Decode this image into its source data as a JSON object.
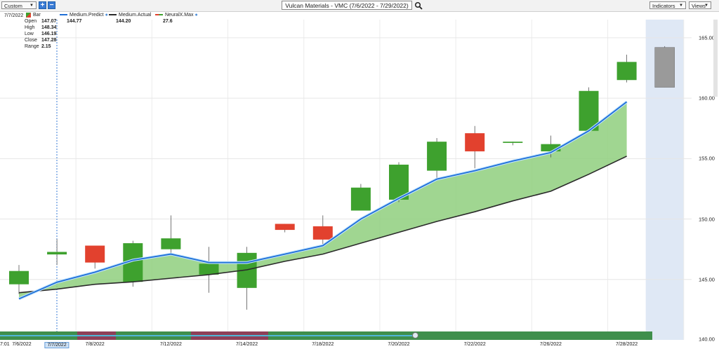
{
  "toolbar": {
    "range_select": "Custom",
    "plus": "+",
    "minus": "−",
    "title": "Vulcan Materials - VMC (7/6/2022 - 7/29/2022)",
    "indicators_label": "Indicators",
    "views_label": "Views"
  },
  "info_panel": {
    "date": "7/7/2022",
    "open_label": "Open",
    "open": "147.07",
    "high_label": "High",
    "high": "148.34",
    "low_label": "Low",
    "low": "146.19",
    "close_label": "Close",
    "close": "147.28",
    "range_label": "Range",
    "range": "2.15"
  },
  "legend": {
    "bar_label": "Bar",
    "predict_label": "Medium.Predict",
    "predict_value": "144.77",
    "actual_label": "Medium.Actual",
    "actual_value": "144.20",
    "neuralx_label": "NeuralX.Max",
    "neuralx_value": "27.6"
  },
  "colors": {
    "up": "#3ea12e",
    "down": "#e2412e",
    "forecast": "#9a9a9a",
    "predict_line": "#1f6fd6",
    "actual_line": "#2a2a2a",
    "fill": "#8fcf7e",
    "highlight": "#dfe8f5"
  },
  "axis_dates": [
    "7/6/2022",
    "7/7/2022",
    "7/8/2022",
    "7/12/2022",
    "7/14/2022",
    "7/18/2022",
    "7/20/2022",
    "7/22/2022",
    "7/26/2022",
    "7/28/2022"
  ],
  "timestamp": "7:01",
  "chart_data": {
    "type": "candlestick",
    "title": "Vulcan Materials - VMC (7/6/2022 - 7/29/2022)",
    "ylim": [
      140,
      166.5
    ],
    "y_ticks": [
      145.0,
      150.0,
      155.0,
      160.0,
      165.0
    ],
    "y_tick_labels": [
      "145.00",
      "150.00",
      "155.00",
      "160.00",
      "165.00"
    ],
    "grid": true,
    "dates": [
      "7/6/2022",
      "7/7/2022",
      "7/8/2022",
      "7/11/2022",
      "7/12/2022",
      "7/13/2022",
      "7/14/2022",
      "7/15/2022",
      "7/18/2022",
      "7/19/2022",
      "7/20/2022",
      "7/21/2022",
      "7/22/2022",
      "7/25/2022",
      "7/26/2022",
      "7/27/2022",
      "7/28/2022",
      "7/29/2022"
    ],
    "candles": [
      {
        "date": "7/6/2022",
        "open": 144.6,
        "high": 146.2,
        "low": 143.8,
        "close": 145.7
      },
      {
        "date": "7/7/2022",
        "open": 147.07,
        "high": 148.34,
        "low": 146.19,
        "close": 147.28
      },
      {
        "date": "7/8/2022",
        "open": 147.8,
        "high": 147.8,
        "low": 145.9,
        "close": 146.4
      },
      {
        "date": "7/11/2022",
        "open": 144.8,
        "high": 148.2,
        "low": 144.4,
        "close": 148.0
      },
      {
        "date": "7/12/2022",
        "open": 147.5,
        "high": 150.3,
        "low": 147.1,
        "close": 148.4
      },
      {
        "date": "7/13/2022",
        "open": 145.4,
        "high": 147.7,
        "low": 143.9,
        "close": 146.3
      },
      {
        "date": "7/14/2022",
        "open": 144.3,
        "high": 147.7,
        "low": 142.5,
        "close": 147.2
      },
      {
        "date": "7/15/2022",
        "open": 149.6,
        "high": 149.6,
        "low": 148.9,
        "close": 149.1
      },
      {
        "date": "7/18/2022",
        "open": 149.4,
        "high": 150.3,
        "low": 147.9,
        "close": 148.3
      },
      {
        "date": "7/19/2022",
        "open": 150.7,
        "high": 152.9,
        "low": 150.7,
        "close": 152.6
      },
      {
        "date": "7/20/2022",
        "open": 151.6,
        "high": 154.7,
        "low": 151.4,
        "close": 154.5
      },
      {
        "date": "7/21/2022",
        "open": 154.0,
        "high": 156.7,
        "low": 153.4,
        "close": 156.4
      },
      {
        "date": "7/22/2022",
        "open": 157.1,
        "high": 157.7,
        "low": 154.2,
        "close": 155.6
      },
      {
        "date": "7/25/2022",
        "open": 156.3,
        "high": 156.4,
        "low": 156.1,
        "close": 156.4
      },
      {
        "date": "7/26/2022",
        "open": 155.6,
        "high": 156.9,
        "low": 155.1,
        "close": 156.2
      },
      {
        "date": "7/27/2022",
        "open": 157.3,
        "high": 160.9,
        "low": 157.2,
        "close": 160.6
      },
      {
        "date": "7/28/2022",
        "open": 161.5,
        "high": 163.6,
        "low": 161.3,
        "close": 163.0
      },
      {
        "date": "7/29/2022",
        "open": 160.9,
        "high": 164.3,
        "low": 160.9,
        "close": 164.2,
        "forecast": true
      }
    ],
    "series": [
      {
        "name": "Medium.Predict",
        "values": [
          143.4,
          144.77,
          145.6,
          146.6,
          147.1,
          146.4,
          146.4,
          147.1,
          147.8,
          150.0,
          151.7,
          153.3,
          154.0,
          154.8,
          155.5,
          157.3,
          159.7
        ]
      },
      {
        "name": "Medium.Actual",
        "values": [
          143.9,
          144.2,
          144.6,
          144.8,
          145.1,
          145.4,
          145.8,
          146.5,
          147.1,
          148.0,
          148.9,
          149.8,
          150.6,
          151.5,
          152.3,
          153.7,
          155.2
        ]
      }
    ]
  }
}
